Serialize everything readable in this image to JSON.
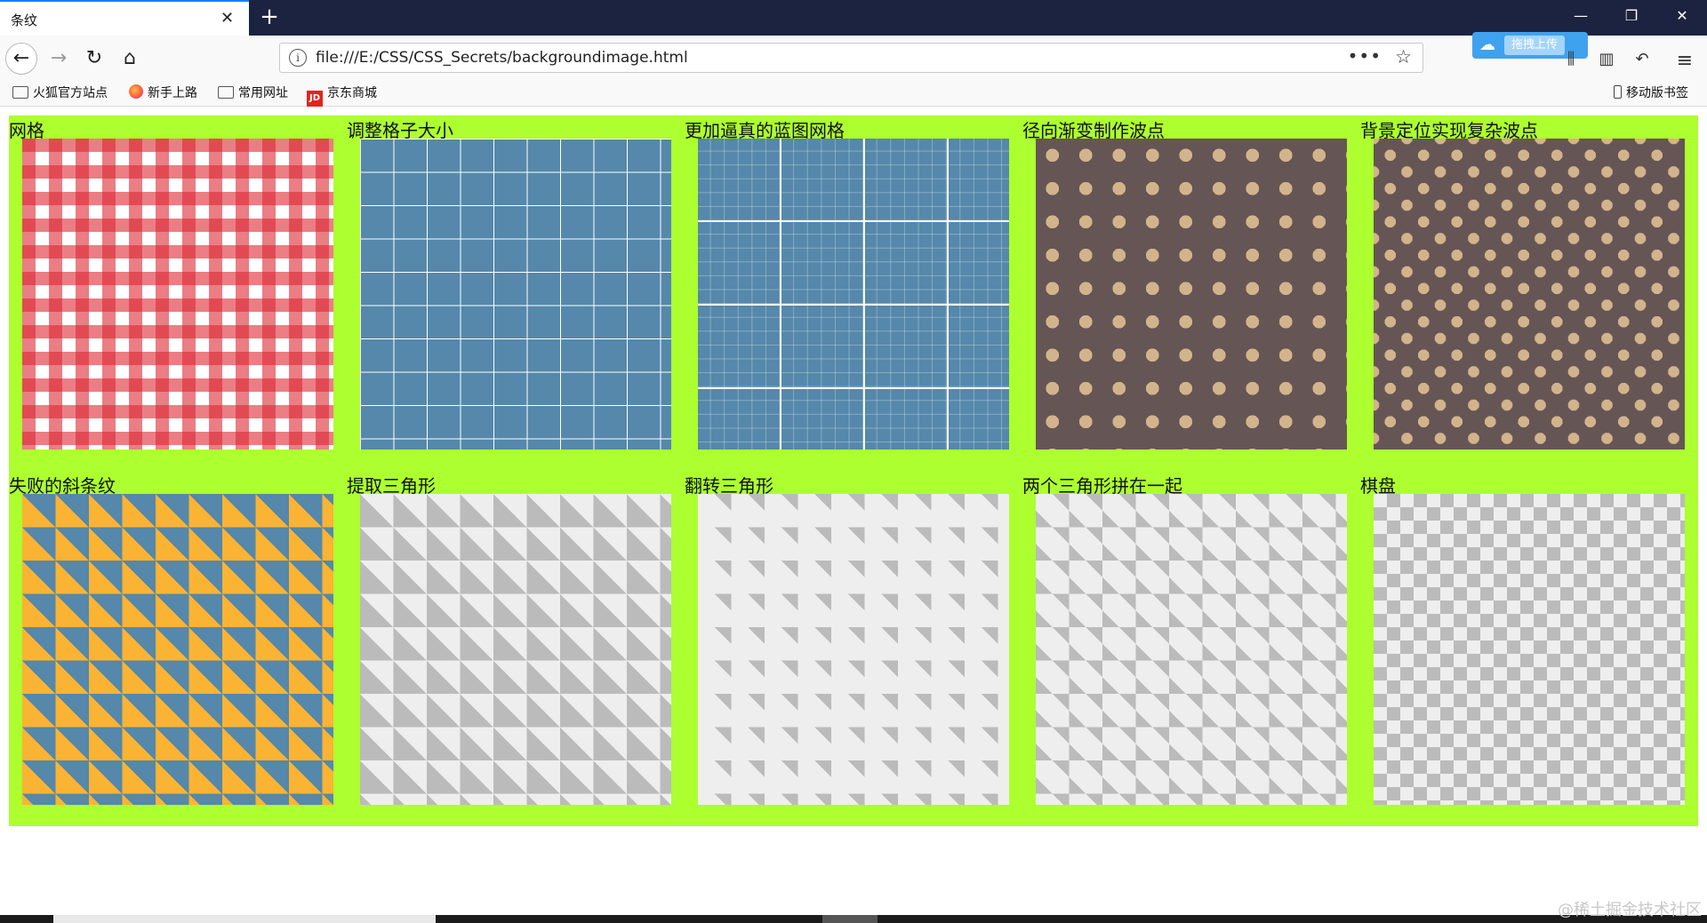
{
  "browser": {
    "tab_title": "条纹",
    "tab_close": "✕",
    "new_tab": "+",
    "window_controls": {
      "minimize": "—",
      "restore": "❐",
      "close": "✕"
    },
    "nav": {
      "back": "←",
      "forward": "→",
      "reload": "↻",
      "home": "⌂"
    },
    "url": "file:///E:/CSS/CSS_Secrets/backgroundimage.html",
    "page_actions": "•••",
    "bookmark_star": "☆",
    "cloud_upload_label": "拖拽上传",
    "toolbar_icons": {
      "library": "⫼",
      "sidebar": "▥",
      "undo": "↶",
      "menu": "≡"
    }
  },
  "bookmarks": {
    "items": [
      {
        "label": "火狐官方站点",
        "icon": "folder-icon"
      },
      {
        "label": "新手上路",
        "icon": "firefox-icon"
      },
      {
        "label": "常用网址",
        "icon": "folder-icon"
      },
      {
        "label": "京东商城",
        "icon": "jd-icon",
        "icon_text": "JD"
      }
    ],
    "mobile": "移动版书签"
  },
  "page": {
    "background": "#adff2f",
    "patterns": [
      {
        "label": "网格",
        "pattern": "gingham"
      },
      {
        "label": "调整格子大小",
        "pattern": "grid"
      },
      {
        "label": "更加逼真的蓝图网格",
        "pattern": "blueprint"
      },
      {
        "label": "径向渐变制作波点",
        "pattern": "polka-dots"
      },
      {
        "label": "背景定位实现复杂波点",
        "pattern": "offset-polka-dots"
      },
      {
        "label": "失败的斜条纹",
        "pattern": "failed-diagonal-stripes"
      },
      {
        "label": "提取三角形",
        "pattern": "triangles"
      },
      {
        "label": "翻转三角形",
        "pattern": "flipped-triangles"
      },
      {
        "label": "两个三角形拼在一起",
        "pattern": "joined-triangles"
      },
      {
        "label": "棋盘",
        "pattern": "checkerboard"
      }
    ]
  },
  "watermark": "@稀土掘金技术社区"
}
